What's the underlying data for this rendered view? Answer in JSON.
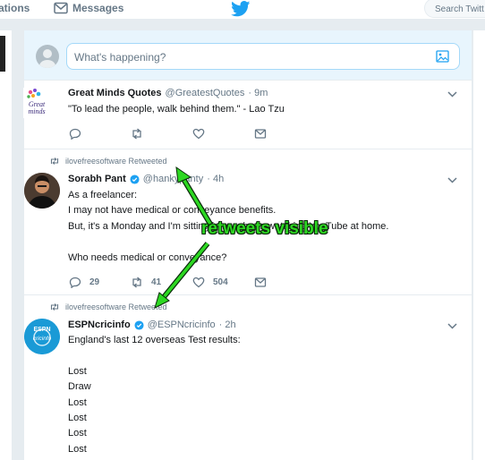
{
  "nav": {
    "notifications_partial": "ations",
    "messages_label": "Messages",
    "search_placeholder": "Search Twitt"
  },
  "compose": {
    "placeholder": "What's happening?"
  },
  "tweets": [
    {
      "retweeted_by": "",
      "name": "Great Minds Quotes",
      "handle": "@GreatestQuotes",
      "time": "· 9m",
      "verified": false,
      "avatar_text": "Great minds",
      "lines": [
        "\"To lead the people, walk behind them.\" - Lao Tzu"
      ],
      "reply_count": "",
      "retweet_count": "",
      "like_count": ""
    },
    {
      "retweeted_by": "ilovefreesoftware Retweeted",
      "name": "Sorabh Pant",
      "handle": "@hankypanty",
      "time": "· 4h",
      "verified": true,
      "lines": [
        "As a freelancer:",
        "I may not have medical or conveyance benefits.",
        "But, it's a Monday and I'm sitting in my shorts watching YouTube at home.",
        "",
        "Who needs medical or conveyance?"
      ],
      "reply_count": "29",
      "retweet_count": "41",
      "like_count": "504"
    },
    {
      "retweeted_by": "ilovefreesoftware Retweeted",
      "name": "ESPNcricinfo",
      "handle": "@ESPNcricinfo",
      "time": "· 2h",
      "verified": true,
      "avatar_text": "ESPN cricinfo",
      "lines": [
        "England's last 12 overseas Test results:",
        "",
        "Lost",
        "Draw",
        "Lost",
        "Lost",
        "Lost",
        "Lost"
      ]
    }
  ],
  "annotation": {
    "label": "retweets visible",
    "color": "#2dd822"
  },
  "colors": {
    "twitter_blue": "#1da1f2",
    "text_secondary": "#657786"
  }
}
